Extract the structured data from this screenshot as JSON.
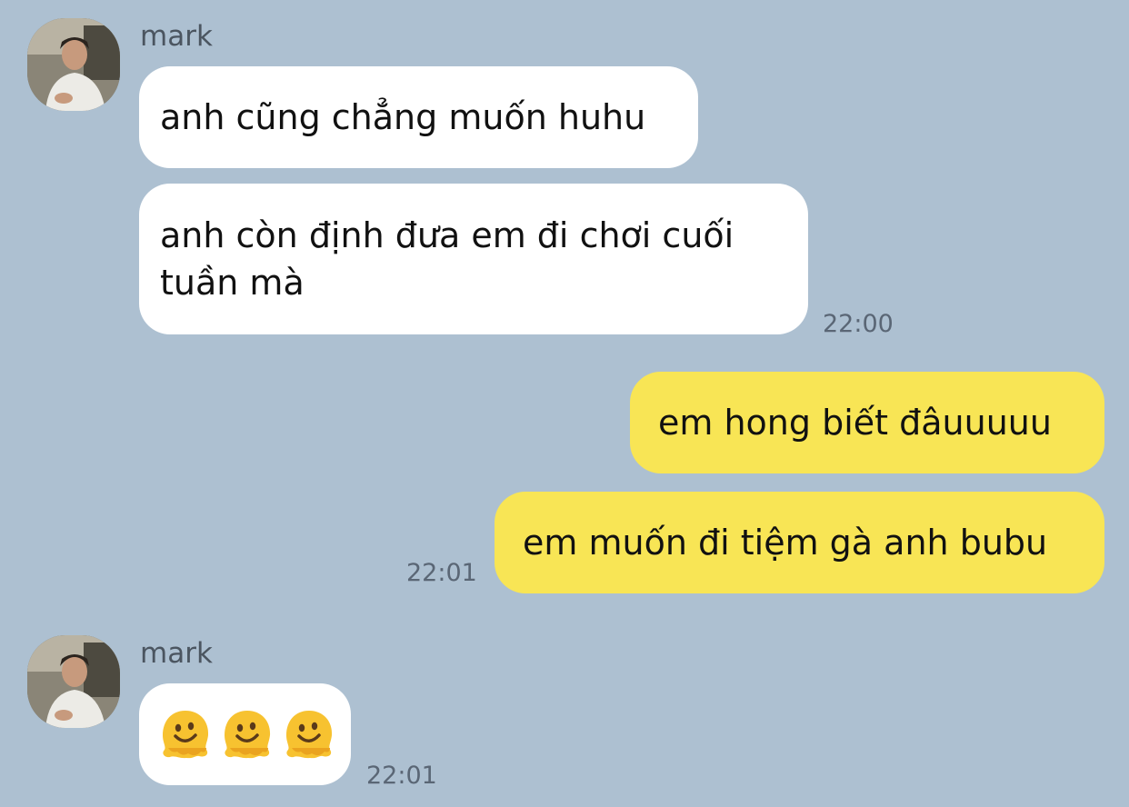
{
  "conversation": {
    "messages": [
      {
        "id": "m1",
        "sender": "mark",
        "text": "anh cũng chẳng muốn huhu"
      },
      {
        "id": "m2",
        "sender": "mark",
        "text": "anh còn định đưa em đi chơi cuối\ntuần mà",
        "time": "22:00"
      },
      {
        "id": "m3",
        "sender": "me",
        "text": "em hong biết đâuuuuu"
      },
      {
        "id": "m4",
        "sender": "me",
        "text": "em muốn đi tiệm gà anh bubu",
        "time": "22:01"
      },
      {
        "id": "m5",
        "sender": "mark",
        "emoji": [
          "melting-face",
          "melting-face",
          "melting-face"
        ],
        "time": "22:01"
      }
    ]
  },
  "contact": {
    "name": "mark"
  },
  "colors": {
    "background": "#adc0d1",
    "incoming_bubble": "#ffffff",
    "outgoing_bubble": "#f8e555",
    "timestamp": "#5a6675"
  }
}
